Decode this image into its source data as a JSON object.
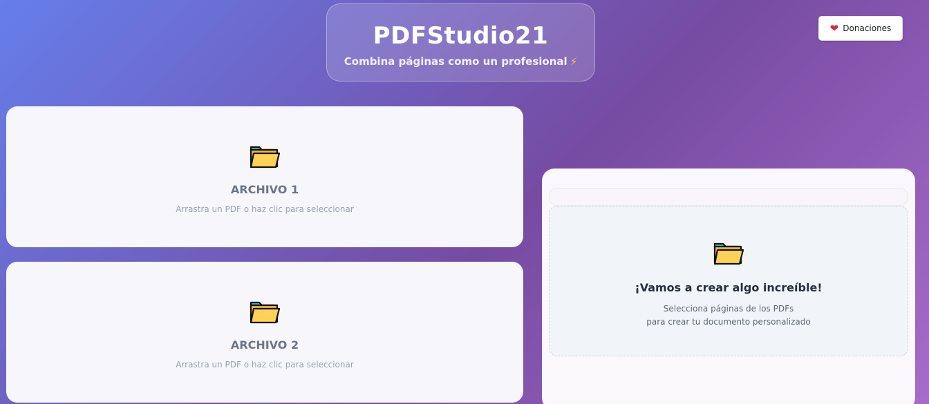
{
  "header": {
    "title": "PDFStudio21",
    "subtitle": "Combina páginas como un profesional",
    "subtitle_icon": "⚡"
  },
  "donate": {
    "label": "Donaciones",
    "icon": "heart-icon"
  },
  "uploads": [
    {
      "title": "ARCHIVO 1",
      "hint": "Arrastra un PDF o haz clic para seleccionar",
      "icon": "folder-icon"
    },
    {
      "title": "ARCHIVO 2",
      "hint": "Arrastra un PDF o haz clic para seleccionar",
      "icon": "folder-icon"
    }
  ],
  "preview": {
    "title": "¡Vamos a crear algo increíble!",
    "desc_line1": "Selecciona páginas de los PDFs",
    "desc_line2": "para crear tu documento personalizado",
    "icon": "folder-icon"
  },
  "colors": {
    "gradient_start": "#667eea",
    "gradient_end": "#764ba2",
    "folder_fill": "#ffd257",
    "folder_tab": "#52b6d6"
  }
}
